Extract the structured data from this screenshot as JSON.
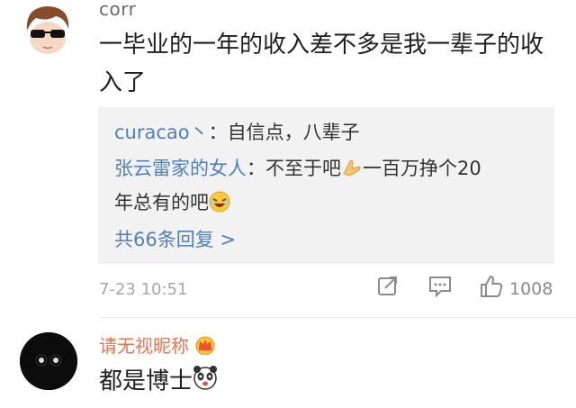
{
  "comment1": {
    "username": "corr",
    "text_line1": "一毕业的一年的收入差不多是我一辈子的收",
    "text_line2": "入了",
    "replies": [
      {
        "name": "curacao丶",
        "text": "：自信点，八辈子"
      },
      {
        "name": "张云雷家的女人",
        "text": "：不至于吧",
        "text_after_emoji": "一百万挣个20",
        "text_line2": "年总有的吧"
      }
    ],
    "more_replies": "共66条回复 >",
    "time": "7-23 10:51",
    "like_count": "1008"
  },
  "comment2": {
    "username": "请无视昵称",
    "text": "都是博士"
  },
  "icons": {
    "share": "share-icon",
    "comment": "comment-icon",
    "like": "thumbs-up-icon",
    "crown": "crown-icon"
  },
  "colors": {
    "username_orange": "#eb7350",
    "link_blue": "#4f7fc1",
    "reply_bg": "#f2f2f2",
    "meta_gray": "#a5a5a5"
  }
}
